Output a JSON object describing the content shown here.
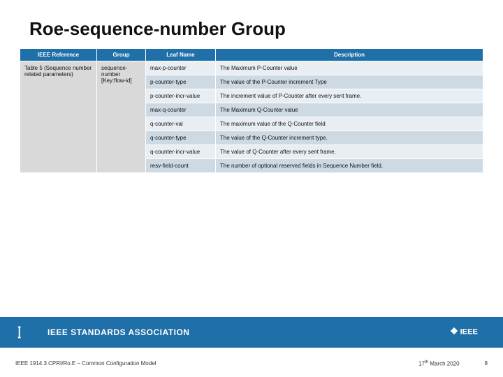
{
  "title": "Roe-sequence-number Group",
  "columns": {
    "c1": "IEEE  Reference",
    "c2": "Group",
    "c3": "Leaf Name",
    "c4": "Description"
  },
  "ref_cell": "Table 5 (Sequence number related parameters)",
  "group_cell": "sequence-number [Key:flow-id]",
  "rows": [
    {
      "leaf": "max-p-counter",
      "desc": "The Maximum P-Counter value"
    },
    {
      "leaf": "p-counter-type",
      "desc": "The value of the P-Counter increment Type"
    },
    {
      "leaf": "p-counter-incr-value",
      "desc": "The increment value of P-Counter after every sent frame."
    },
    {
      "leaf": "max-q-counter",
      "desc": "The Maximum Q-Counter value"
    },
    {
      "leaf": "q-counter-val",
      "desc": "The maximum value of the Q-Counter field"
    },
    {
      "leaf": "q-counter-type",
      "desc": "The value of the Q-Counter increment type."
    },
    {
      "leaf": "q-counter-incr-value",
      "desc": "The value of Q-Counter after every sent frame."
    },
    {
      "leaf": "resv-field-count",
      "desc": "The number of optional reserved fields in Sequence Number field."
    }
  ],
  "footer": {
    "brand": "IEEE STANDARDS ASSOCIATION",
    "doc": "IEEE 1914.3 CPRI/Ro.E – Common Configuration Model",
    "date_prefix": "17",
    "date_suffix": " March 2020",
    "page": "8"
  },
  "chart_data": {
    "type": "table",
    "title": "Roe-sequence-number Group",
    "columns": [
      "IEEE Reference",
      "Group",
      "Leaf Name",
      "Description"
    ],
    "rows": [
      [
        "Table 5 (Sequence number related parameters)",
        "sequence-number [Key:flow-id]",
        "max-p-counter",
        "The Maximum P-Counter value"
      ],
      [
        "",
        "",
        "p-counter-type",
        "The value of the P-Counter increment Type"
      ],
      [
        "",
        "",
        "p-counter-incr-value",
        "The increment value of P-Counter after every sent frame."
      ],
      [
        "",
        "",
        "max-q-counter",
        "The Maximum Q-Counter value"
      ],
      [
        "",
        "",
        "q-counter-val",
        "The maximum value of the Q-Counter field"
      ],
      [
        "",
        "",
        "q-counter-type",
        "The value of the Q-Counter increment type."
      ],
      [
        "",
        "",
        "q-counter-incr-value",
        "The value of Q-Counter after every sent frame."
      ],
      [
        "",
        "",
        "resv-field-count",
        "The number of optional reserved fields in Sequence Number field."
      ]
    ]
  }
}
